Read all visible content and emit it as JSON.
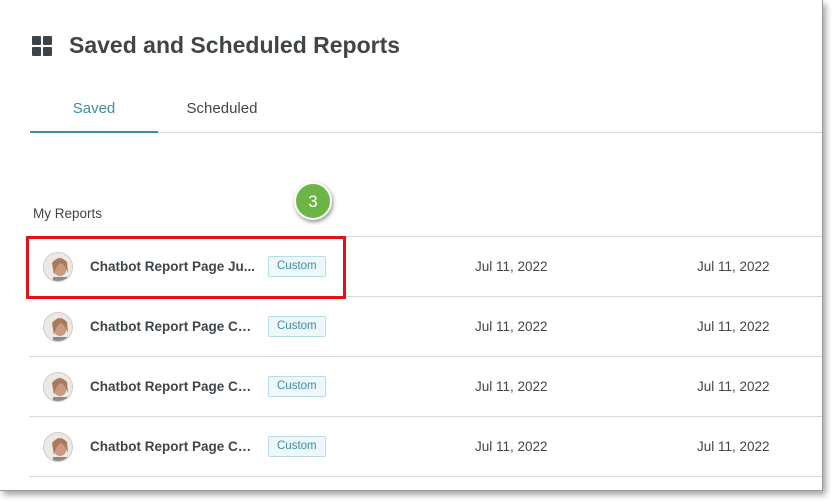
{
  "header": {
    "title": "Saved and Scheduled Reports",
    "icon": "dashboard-grid-icon"
  },
  "tabs": [
    {
      "label": "Saved",
      "active": true
    },
    {
      "label": "Scheduled",
      "active": false
    }
  ],
  "section": {
    "label": "My Reports"
  },
  "callout": {
    "number": "3",
    "color": "#6cb544"
  },
  "highlight_color": "#e2121a",
  "reports": [
    {
      "name": "Chatbot Report Page Ju...",
      "tag": "Custom",
      "date_created": "Jul 11, 2022",
      "date_modified": "Jul 11, 2022"
    },
    {
      "name": "Chatbot Report Page Co...",
      "tag": "Custom",
      "date_created": "Jul 11, 2022",
      "date_modified": "Jul 11, 2022"
    },
    {
      "name": "Chatbot Report Page Co...",
      "tag": "Custom",
      "date_created": "Jul 11, 2022",
      "date_modified": "Jul 11, 2022"
    },
    {
      "name": "Chatbot Report Page Co...",
      "tag": "Custom",
      "date_created": "Jul 11, 2022",
      "date_modified": "Jul 11, 2022"
    }
  ]
}
